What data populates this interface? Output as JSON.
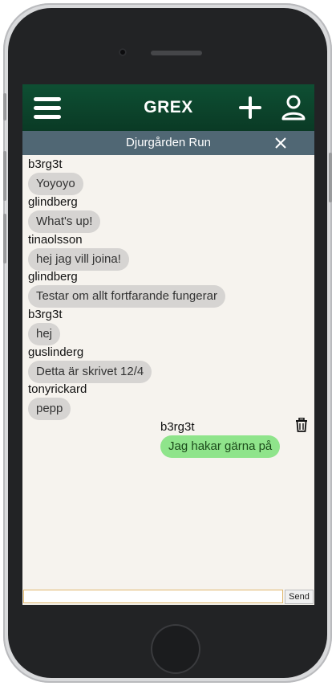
{
  "app": {
    "title": "GREX",
    "room_title": "Djurgården Run"
  },
  "icons": {
    "menu": "menu-icon",
    "add": "plus-icon",
    "user": "user-icon",
    "close": "close-icon",
    "delete": "trash-icon"
  },
  "colors": {
    "header_bg": "#0b3f28",
    "subheader_bg": "#506774",
    "chat_bg": "#f6f3ee",
    "bubble_other": "#d6d4d2",
    "bubble_own": "#8fe48b"
  },
  "messages": [
    {
      "user": "b3rg3t",
      "text": "Yoyoyo"
    },
    {
      "user": "glindberg",
      "text": "What's up!"
    },
    {
      "user": "tinaolsson",
      "text": "hej jag vill joina!"
    },
    {
      "user": "glindberg",
      "text": "Testar om allt fortfarande fungerar"
    },
    {
      "user": "b3rg3t",
      "text": "hej"
    },
    {
      "user": "guslinderg",
      "text": "Detta är skrivet 12/4"
    },
    {
      "user": "tonyrickard",
      "text": "pepp"
    }
  ],
  "own_message": {
    "user": "b3rg3t",
    "text": "Jag hakar gärna på"
  },
  "composer": {
    "input_value": "",
    "send_label": "Send"
  }
}
